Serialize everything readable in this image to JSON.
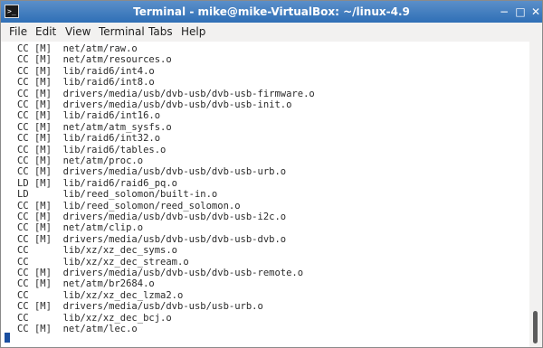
{
  "window": {
    "title": "Terminal - mike@mike-VirtualBox: ~/linux-4.9",
    "app_icon": ">_",
    "controls": {
      "minimize": "−",
      "maximize": "□",
      "close": "✕"
    }
  },
  "menu": [
    "File",
    "Edit",
    "View",
    "Terminal",
    "Tabs",
    "Help"
  ],
  "terminal": {
    "lines": [
      "CC [M]  net/atm/raw.o",
      "CC [M]  net/atm/resources.o",
      "CC [M]  lib/raid6/int4.o",
      "CC [M]  lib/raid6/int8.o",
      "CC [M]  drivers/media/usb/dvb-usb/dvb-usb-firmware.o",
      "CC [M]  drivers/media/usb/dvb-usb/dvb-usb-init.o",
      "CC [M]  lib/raid6/int16.o",
      "CC [M]  net/atm/atm_sysfs.o",
      "CC [M]  lib/raid6/int32.o",
      "CC [M]  lib/raid6/tables.o",
      "CC [M]  net/atm/proc.o",
      "CC [M]  drivers/media/usb/dvb-usb/dvb-usb-urb.o",
      "LD [M]  lib/raid6/raid6_pq.o",
      "LD      lib/reed_solomon/built-in.o",
      "CC [M]  lib/reed_solomon/reed_solomon.o",
      "CC [M]  drivers/media/usb/dvb-usb/dvb-usb-i2c.o",
      "CC [M]  net/atm/clip.o",
      "CC [M]  drivers/media/usb/dvb-usb/dvb-usb-dvb.o",
      "CC      lib/xz/xz_dec_syms.o",
      "CC      lib/xz/xz_dec_stream.o",
      "CC [M]  drivers/media/usb/dvb-usb/dvb-usb-remote.o",
      "CC [M]  net/atm/br2684.o",
      "CC      lib/xz/xz_dec_lzma2.o",
      "CC [M]  drivers/media/usb/dvb-usb/usb-urb.o",
      "CC      lib/xz/xz_dec_bcj.o",
      "CC [M]  net/atm/lec.o"
    ]
  },
  "colors": {
    "titlebar": "#3a78bd",
    "cursor": "#1b4fa0",
    "text": "#2a2a2a"
  }
}
